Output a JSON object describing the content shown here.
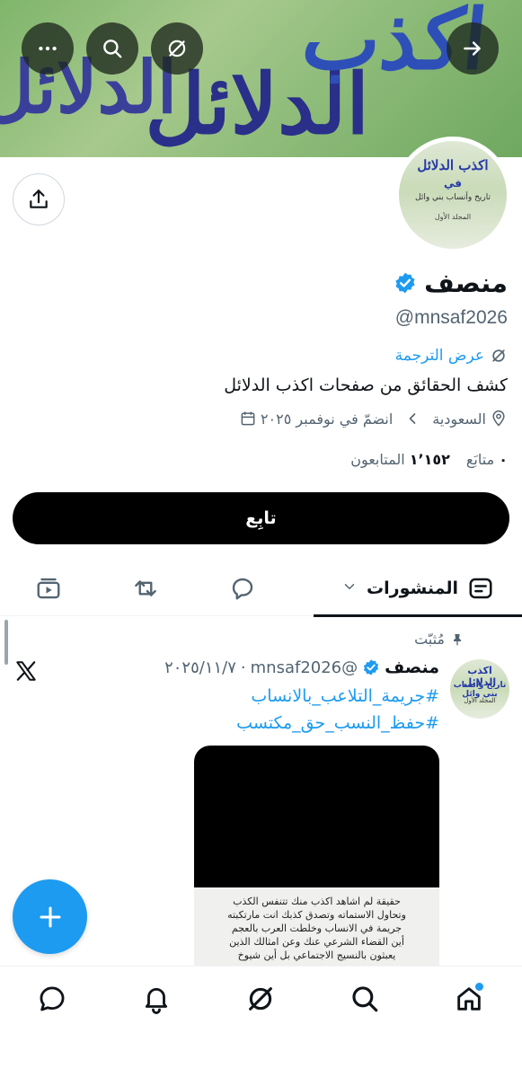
{
  "banner": {
    "text_line1": "اكذب",
    "text_line2": "الدلائل",
    "text_line3": "الدلائل"
  },
  "header_buttons": {
    "back_icon": "arrow-right-icon",
    "translate_icon": "grok-icon",
    "search_icon": "search-icon",
    "more_icon": "more-icon"
  },
  "avatar": {
    "line1": "اكذب الدلائل",
    "line2": "في",
    "line3": "تاريخ وأنساب بني وائل",
    "line4": "المجلد الأول"
  },
  "profile": {
    "name": "منصف",
    "handle": "@mnsaf2026",
    "translate_label": "عرض الترجمة",
    "bio": "كشف الحقائق من صفحات اكذب الدلائل",
    "location": "السعودية",
    "joined": "انضمّ في نوفمبر ٢٠٢٥",
    "following_count": "٠",
    "following_label": "متابَع",
    "followers_count": "١٬١٥٢",
    "followers_label": "المتابعون",
    "follow_button": "تابِع"
  },
  "tabs": {
    "posts_label": "المنشورات"
  },
  "post": {
    "pinned_label": "مُثبّت",
    "author_name": "منصف",
    "author_handle": "@mnsaf2026",
    "date": "٢٠٢٥/١١/٧",
    "separator": "·",
    "hashtag1": "#جريمة_التلاعب_بالانساب",
    "hashtag2": "#حفظ_النسب_حق_مكتسب",
    "media_text_lines": [
      "حقيقة لم اشاهد اكذب منك تتنفس الكذب",
      "وتحاول الاستماته وتصدق كذبك انت مارتكبته",
      "جريمة في الانساب وخلطت العرب بالعجم",
      "أين القضاء الشرعي عنك وعن امثالك الذين",
      "يعبثون بالنسيج الاجتماعي بل أين شيوخ"
    ]
  },
  "colors": {
    "accent": "#1d9bf0",
    "text": "#0f1419",
    "muted": "#536471"
  }
}
